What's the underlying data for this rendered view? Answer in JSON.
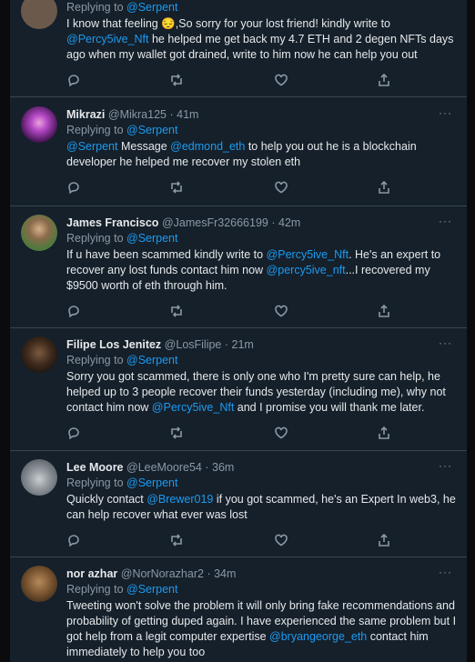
{
  "tweets": [
    {
      "replying_prefix": "Replying to ",
      "replying_to": "@Serpent",
      "body": [
        {
          "t": "I know that feeling 😔,So sorry for your lost friend! kindly write to "
        },
        {
          "t": "@Percy5ive_Nft",
          "link": true
        },
        {
          "t": " he helped me get back my 4.7 ETH and 2 degen NFTs days ago when my wallet got drained, write to him now he can help you out"
        }
      ]
    },
    {
      "name": "Mikrazi",
      "handle": "@Mikra125",
      "time": "41m",
      "replying_prefix": "Replying to ",
      "replying_to": "@Serpent",
      "body": [
        {
          "t": "@Serpent",
          "link": true
        },
        {
          "t": " Message "
        },
        {
          "t": "@edmond_eth",
          "link": true
        },
        {
          "t": " to help you out he is a blockchain developer he helped me recover my stolen eth"
        }
      ]
    },
    {
      "name": "James Francisco",
      "handle": "@JamesFr32666199",
      "time": "42m",
      "replying_prefix": "Replying to ",
      "replying_to": "@Serpent",
      "body": [
        {
          "t": "If u have been scammed kindly write to "
        },
        {
          "t": "@Percy5ive_Nft",
          "link": true
        },
        {
          "t": ".  He's an expert to recover any lost funds contact him now "
        },
        {
          "t": "@percy5ive_nft",
          "link": true
        },
        {
          "t": "...I recovered my $9500 worth of eth through him."
        }
      ]
    },
    {
      "name": "Filipe Los Jenitez",
      "handle": "@LosFilipe",
      "time": "21m",
      "replying_prefix": "Replying to ",
      "replying_to": "@Serpent",
      "body": [
        {
          "t": "Sorry you got scammed, there is only one who I'm pretty sure can help, he helped up to 3 people recover their funds yesterday (including me), why not contact him now "
        },
        {
          "t": "@Percy5ive_Nft",
          "link": true
        },
        {
          "t": " and I promise you will thank me later."
        }
      ]
    },
    {
      "name": "Lee Moore",
      "handle": "@LeeMoore54",
      "time": "36m",
      "replying_prefix": "Replying to ",
      "replying_to": "@Serpent",
      "body": [
        {
          "t": "Quickly contact "
        },
        {
          "t": "@Brewer019",
          "link": true
        },
        {
          "t": " if you got scammed, he's an Expert In web3, he can help recover what ever was lost"
        }
      ]
    },
    {
      "name": "nor azhar",
      "handle": "@NorNorazhar2",
      "time": "34m",
      "replying_prefix": "Replying to ",
      "replying_to": "@Serpent",
      "body": [
        {
          "t": "Tweeting won't solve the problem it will only bring fake recommendations and probability of getting duped again. I have experienced the same problem but I got help from a legit computer expertise "
        },
        {
          "t": "@bryangeorge_eth",
          "link": true
        },
        {
          "t": " contact him immediately to help you too"
        }
      ]
    }
  ],
  "dot": "·",
  "more_label": "···"
}
